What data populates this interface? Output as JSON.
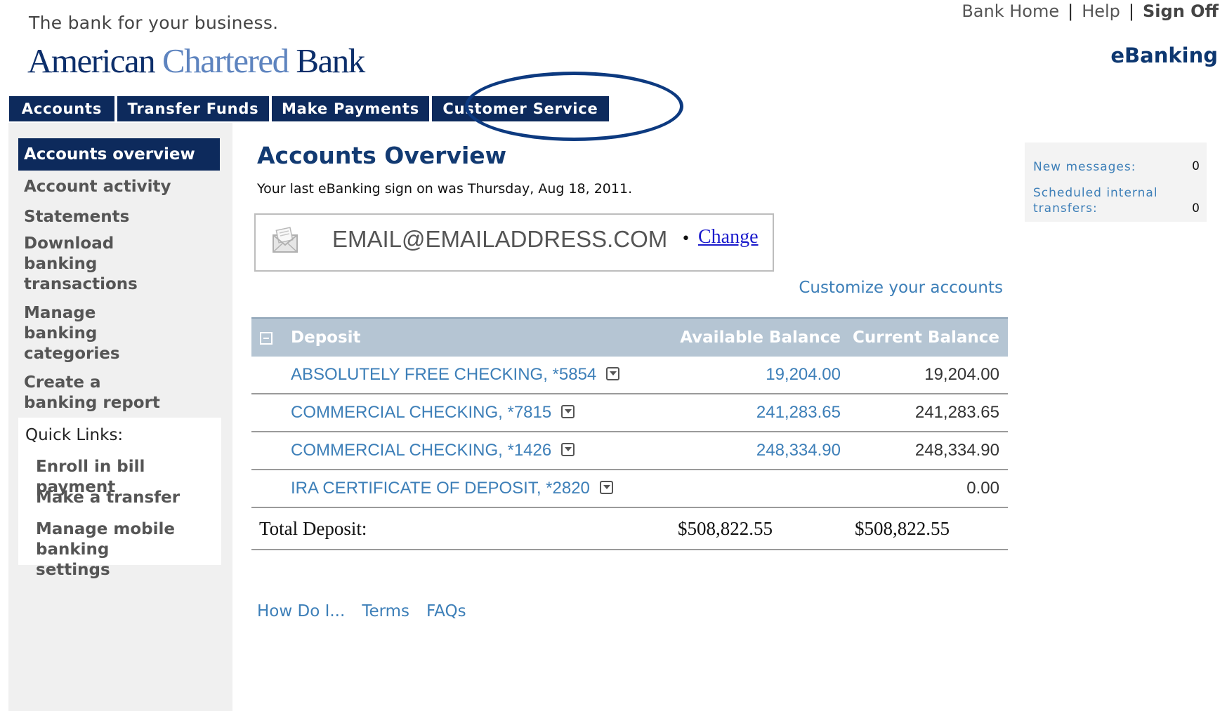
{
  "header": {
    "tagline": "The bank for your business.",
    "logo": {
      "word1": "American",
      "word2": "Chartered",
      "word3": "Bank"
    },
    "top_links": [
      "Bank Home",
      "Help",
      "Sign Off"
    ],
    "separator": "|",
    "ebanking": "eBanking"
  },
  "nav": {
    "tabs": [
      "Accounts",
      "Transfer Funds",
      "Make Payments",
      "Customer Service"
    ],
    "highlighted_tab": "Customer Service"
  },
  "sidebar": {
    "items": [
      "Accounts overview",
      "Account activity",
      "Statements",
      "Download banking transactions",
      "Manage banking categories",
      "Create a banking report"
    ],
    "active_item": "Accounts overview",
    "quick_links": {
      "title": "Quick Links:",
      "items": [
        "Enroll in bill payment",
        "Make a transfer",
        "Manage mobile banking settings"
      ]
    }
  },
  "main": {
    "title": "Accounts Overview",
    "last_signon": "Your last eBanking sign on was Thursday, Aug 18, 2011.",
    "email": "EMAIL@EMAILADDRESS.COM",
    "bullet": "•",
    "change_link": "Change",
    "customize_link": "Customize your accounts",
    "table": {
      "headers": [
        "Deposit",
        "Available Balance",
        "Current Balance"
      ],
      "rows": [
        {
          "account": "ABSOLUTELY FREE CHECKING, *5854",
          "available": "19,204.00",
          "current": "19,204.00"
        },
        {
          "account": "COMMERCIAL CHECKING, *7815",
          "available": "241,283.65",
          "current": "241,283.65"
        },
        {
          "account": "COMMERCIAL CHECKING, *1426",
          "available": "248,334.90",
          "current": "248,334.90"
        },
        {
          "account": "IRA CERTIFICATE OF DEPOSIT, *2820",
          "available": "",
          "current": "0.00"
        }
      ],
      "total_label": "Total Deposit:",
      "total_available": "$508,822.55",
      "total_current": "$508,822.55"
    },
    "footer_links": [
      "How Do I...",
      "Terms",
      "FAQs"
    ]
  },
  "messages": {
    "new_messages_label": "New messages:",
    "new_messages_value": "0",
    "scheduled_label_line1": "Scheduled internal",
    "scheduled_label_line2": "transfers:",
    "scheduled_value": "0"
  },
  "colors": {
    "navy": "#0d2a5c",
    "link_blue": "#3d7fb8",
    "header_gray_blue": "#b5c5d3",
    "annotation_circle": "#0d3a80"
  }
}
